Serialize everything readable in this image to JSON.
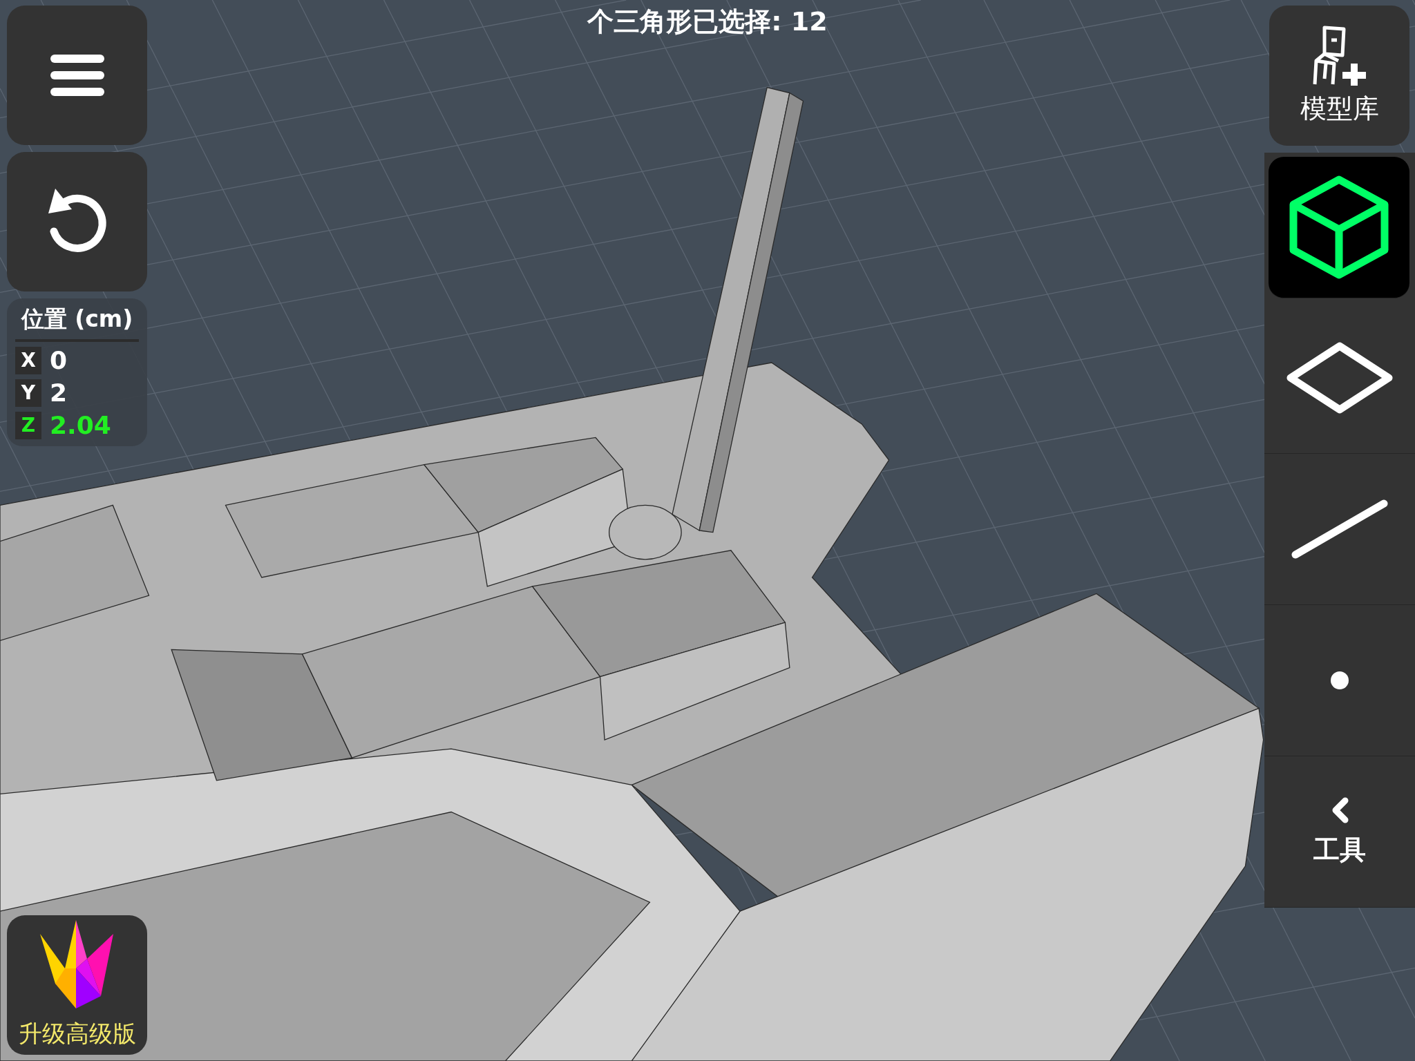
{
  "status": {
    "selection_text": "个三角形已选择: 12"
  },
  "position_panel": {
    "title": "位置 (cm)",
    "axes": [
      {
        "axis": "X",
        "value": "0",
        "active": false
      },
      {
        "axis": "Y",
        "value": "2",
        "active": false
      },
      {
        "axis": "Z",
        "value": "2.04",
        "active": true
      }
    ]
  },
  "library_button": {
    "label": "模型库"
  },
  "mode_toolbar": [
    {
      "kind": "object",
      "selected": true
    },
    {
      "kind": "face",
      "selected": false
    },
    {
      "kind": "edge",
      "selected": false
    },
    {
      "kind": "vertex",
      "selected": false
    },
    {
      "kind": "tools",
      "label": "工具",
      "selected": false
    }
  ],
  "upgrade_button": {
    "label": "升级高级版"
  }
}
